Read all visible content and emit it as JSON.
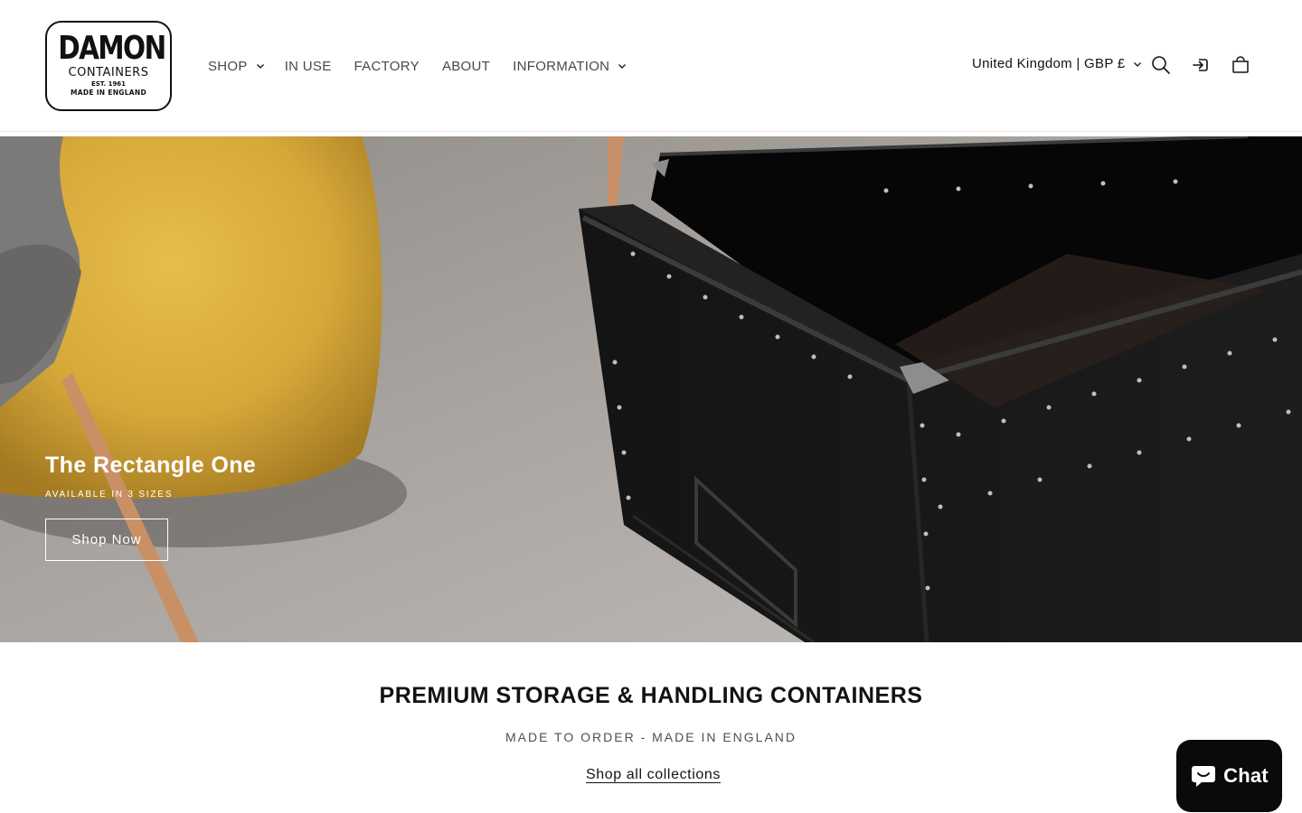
{
  "brand": {
    "logo_main": "DAMON",
    "logo_sub": "CONTAINERS",
    "logo_est": "EST. 1961",
    "logo_made": "MADE IN ENGLAND"
  },
  "nav": {
    "items": [
      {
        "label": "SHOP",
        "has_dropdown": true
      },
      {
        "label": "IN USE",
        "has_dropdown": false
      },
      {
        "label": "FACTORY",
        "has_dropdown": false
      },
      {
        "label": "ABOUT",
        "has_dropdown": false
      },
      {
        "label": "INFORMATION",
        "has_dropdown": true
      }
    ]
  },
  "header": {
    "locale": "United Kingdom | GBP £",
    "icons": [
      "search-icon",
      "account-icon",
      "cart-icon"
    ]
  },
  "hero": {
    "title": "The Rectangle One",
    "subtitle": "AVAILABLE IN 3 SIZES",
    "button_label": "Shop Now"
  },
  "main": {
    "title": "PREMIUM STORAGE & HANDLING CONTAINERS",
    "subtitle": "MADE TO ORDER - MADE IN ENGLAND",
    "link_label": "Shop all collections"
  },
  "chat": {
    "label": "Chat",
    "icon": "chat-bubble-icon"
  },
  "colors": {
    "text": "#121212",
    "chat_bg": "#0a0a0a",
    "hero_text": "#ffffff"
  }
}
